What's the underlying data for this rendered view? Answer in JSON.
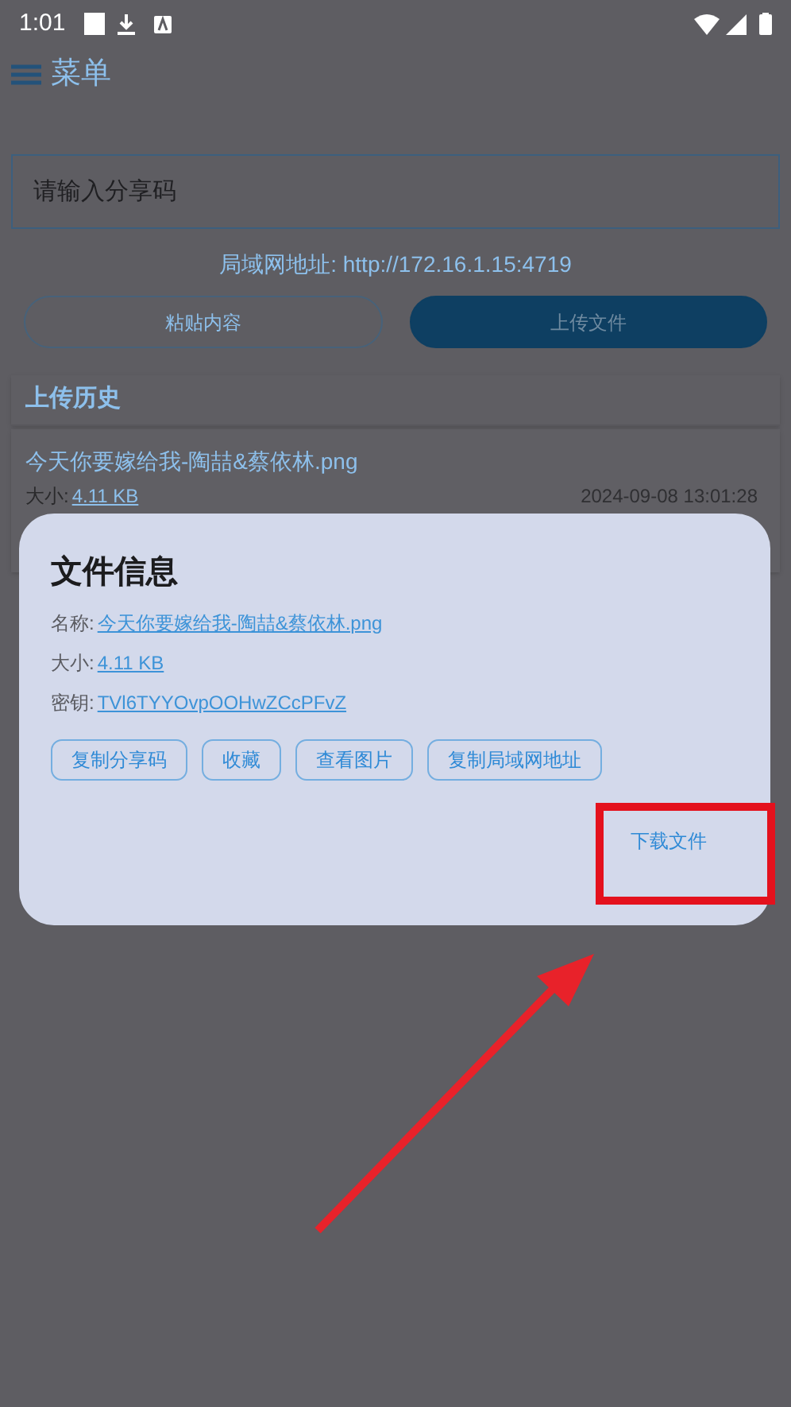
{
  "status_bar": {
    "time": "1:01"
  },
  "header": {
    "title": "菜单"
  },
  "share_code_field": {
    "placeholder": "请输入分享码"
  },
  "lan_address": "局域网地址: http://172.16.1.15:4719",
  "buttons": [
    {
      "label": "粘贴内容",
      "kind": "outline"
    },
    {
      "label": "上传文件",
      "kind": "filled"
    }
  ],
  "history": {
    "title": "上传历史",
    "items": [
      {
        "name": "今天你要嫁给我-陶喆&蔡依林.png",
        "size_label": "大小:",
        "size": "4.11 KB",
        "time": "2024-09-08 13:01:28"
      }
    ]
  },
  "dialog": {
    "title": "文件信息",
    "fields": [
      {
        "label": "名称:",
        "value": "今天你要嫁给我-陶喆&蔡依林.png"
      },
      {
        "label": "大小:",
        "value": "4.11 KB"
      },
      {
        "label": "密钥:",
        "value": "TVl6TYYOvpOOHwZCcPFvZ"
      }
    ],
    "actions": [
      "复制分享码",
      "收藏",
      "查看图片",
      "复制局域网地址"
    ],
    "download_button": "下载文件"
  }
}
